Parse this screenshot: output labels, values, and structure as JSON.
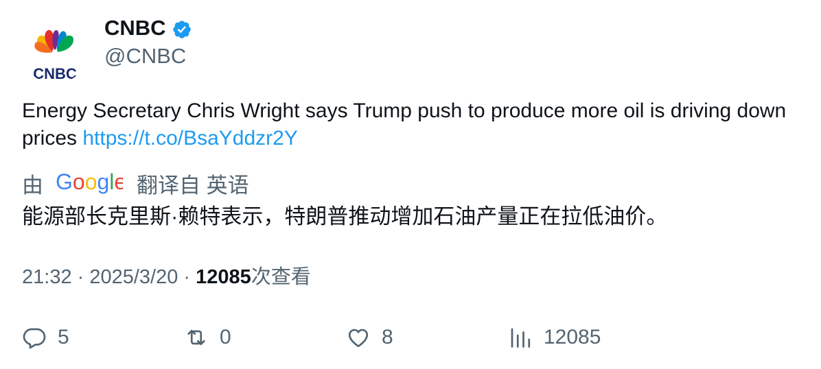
{
  "author": {
    "display_name": "CNBC",
    "handle": "@CNBC",
    "verified": true,
    "avatar_icon": "cnbc-peacock-logo",
    "avatar_text": "CNBC"
  },
  "tweet": {
    "text": "Energy Secretary Chris Wright says Trump push to produce more oil is driving down prices ",
    "link": "https://t.co/BsaYddzr2Y"
  },
  "translation": {
    "by_label": "由",
    "provider": "Google",
    "from_label": "翻译自 英语",
    "text": "能源部长克里斯·赖特表示，特朗普推动增加石油产量正在拉低油价。"
  },
  "meta": {
    "time": "21:32",
    "separator1": " · ",
    "date": "2025/3/20",
    "separator2": " · ",
    "views_count": "12085",
    "views_label": "次查看"
  },
  "actions": {
    "replies": "5",
    "retweets": "0",
    "likes": "8",
    "views": "12085"
  },
  "colors": {
    "link": "#1d9bf0",
    "secondary_text": "#536471",
    "primary_text": "#0f1419",
    "verified_badge": "#1d9bf0"
  }
}
